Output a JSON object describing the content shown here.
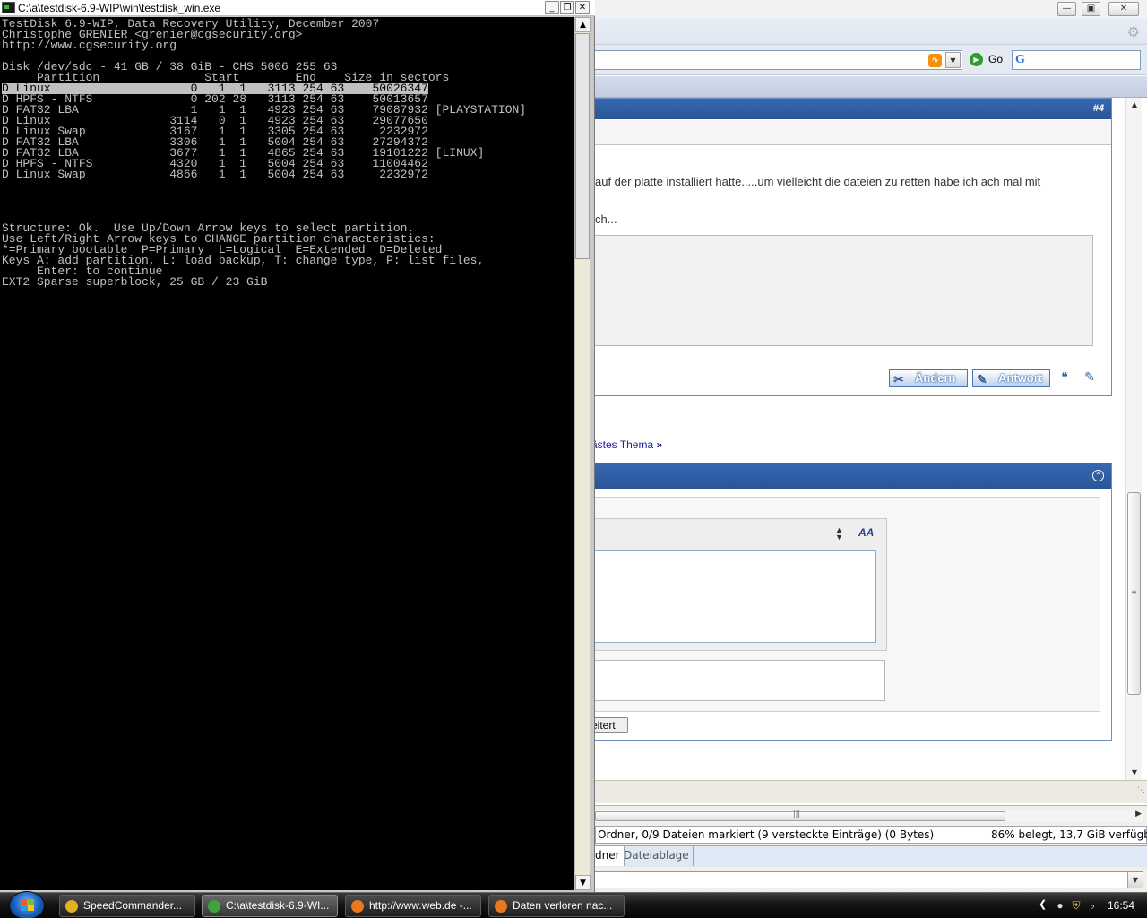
{
  "console": {
    "title": "C:\\a\\testdisk-6.9-WIP\\win\\testdisk_win.exe",
    "lines": [
      "TestDisk 6.9-WIP, Data Recovery Utility, December 2007",
      "Christophe GRENIER <grenier@cgsecurity.org>",
      "http://www.cgsecurity.org",
      "",
      "Disk /dev/sdc - 41 GB / 38 GiB - CHS 5006 255 63",
      "     Partition               Start        End    Size in sectors",
      "D Linux                    0   1  1   3113 254 63    50026347",
      "D HPFS - NTFS              0 202 28   3113 254 63    50013657",
      "D FAT32 LBA                1   1  1   4923 254 63    79087932 [PLAYSTATION]",
      "D Linux                 3114   0  1   4923 254 63    29077650",
      "D Linux Swap            3167   1  1   3305 254 63     2232972",
      "D FAT32 LBA             3306   1  1   5004 254 63    27294372",
      "D FAT32 LBA             3677   1  1   4865 254 63    19101222 [LINUX]",
      "D HPFS - NTFS           4320   1  1   5004 254 63    11004462",
      "D Linux Swap            4866   1  1   5004 254 63     2232972",
      "",
      "",
      "",
      "",
      "Structure: Ok.  Use Up/Down Arrow keys to select partition.",
      "Use Left/Right Arrow keys to CHANGE partition characteristics:",
      "*=Primary bootable  P=Primary  L=Logical  E=Extended  D=Deleted",
      "Keys A: add partition, L: load backup, T: change type, P: list files,",
      "     Enter: to continue",
      "EXT2 Sparse superblock, 25 GB / 23 GiB"
    ],
    "highlighted_line": 6
  },
  "browser": {
    "go_label": "Go",
    "post_number": "#4",
    "post_text_1": "auf der platte installiert hatte.....um vielleicht die dateien zu retten habe ich ach mal mit",
    "post_text_2": "ch...",
    "button_edit": "Ändern",
    "button_reply": "Antwort",
    "next_thread": "ästes Thema",
    "next_arrow": "»",
    "continue_button": "eitert"
  },
  "file_manager": {
    "status_left": "Ordner, 0/9 Dateien markiert (9 versteckte Einträge) (0 Bytes)",
    "status_right": "86% belegt, 13,7 GiB verfügbar",
    "tab_folder": "dner",
    "tab_clipboard": "Dateiablage"
  },
  "taskbar": {
    "items": [
      {
        "label": "SpeedCommander...",
        "icon": "speedcommander-icon"
      },
      {
        "label": "C:\\a\\testdisk-6.9-WI...",
        "icon": "console-icon"
      },
      {
        "label": "http://www.web.de -...",
        "icon": "firefox-icon"
      },
      {
        "label": "Daten verloren nac...",
        "icon": "firefox-icon"
      }
    ],
    "active_index": 1,
    "clock": "16:54"
  },
  "colors": {
    "console_bg": "#000000",
    "console_text": "#c0c0c0",
    "forum_header_blue": "#2b5596",
    "taskbar_bg": "#141414"
  }
}
